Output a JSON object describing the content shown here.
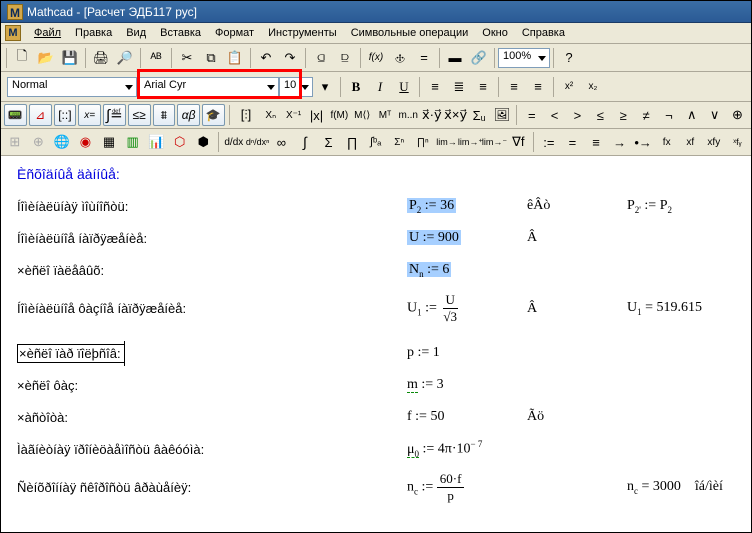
{
  "window": {
    "title": "Mathcad - [Расчет ЭДБ117 рус]"
  },
  "menu": {
    "file": "Файл",
    "edit": "Правка",
    "view": "Вид",
    "insert": "Вставка",
    "format": "Формат",
    "tools": "Инструменты",
    "symbolic": "Символьные операции",
    "window": "Окно",
    "help": "Справка"
  },
  "toolbar": {
    "zoom": "100%",
    "style": "Normal",
    "font": "Arial Cyr",
    "size": "10",
    "bold": "B",
    "italic": "I",
    "underline": "U"
  },
  "icons": {
    "new": "🗋",
    "open": "📂",
    "save": "💾",
    "print": "🖨",
    "preview": "🔎",
    "spell": "ᴬᴮ",
    "cut": "✂",
    "copy": "⧉",
    "paste": "📋",
    "undo": "↶",
    "redo": "↷",
    "align": "≡",
    "fx": "f(x)",
    "equals": "=",
    "help": "?"
  },
  "doc": {
    "header": "Èñõîäíûå äàííûå:",
    "r1": {
      "lbl": "Íîìèíàëüíàÿ ìîùíîñòü:",
      "expr_lhs": "P",
      "expr_sub": "2",
      "expr_rhs": " := 36",
      "unit": "êÂò",
      "res_lhs": "P",
      "res_sub": "2'",
      "res_rhs": " := P",
      "res_sub2": "2"
    },
    "r2": {
      "lbl": "Íîìèíàëüíîå íàïðÿæåíèå:",
      "expr": "U := 900",
      "unit": "Â"
    },
    "r3": {
      "lbl": "×èñëî ïàëåâûõ:",
      "expr_lhs": "N",
      "expr_sub": "n",
      "expr_rhs": " := 6"
    },
    "r4": {
      "lbl": "Íîìèíàëüíîå ôàçíîå íàïðÿæåíèå:",
      "u1": "U",
      "u1sub": "1",
      "assign": " := ",
      "numU": "U",
      "denSqrt": "√3",
      "unit": "Â",
      "res": "U",
      "res_sub": "1",
      "res_val": " = 519.615"
    },
    "r5": {
      "lbl": "×èñëî ïàð ïîëþñîâ:",
      "expr": "p := 1"
    },
    "r6": {
      "lbl": "×èñëî ôàç:",
      "expr_lhs": "m",
      "expr_rhs": " := 3"
    },
    "r7": {
      "lbl": "×àñòîòà:",
      "expr": "f := 50",
      "unit": "Ãö"
    },
    "r8": {
      "lbl": "Ìàãíèòíàÿ ïðîíèöàåìîñòü âàêóóìà:",
      "mu": "μ",
      "mu_sub": "0",
      "expr_rhs": " := 4π·10",
      "sup": "− 7"
    },
    "r9": {
      "lbl": "Ñèíõðîííàÿ ñêîðîñòü âðàùåíèÿ:",
      "nc": "n",
      "nc_sub": "c",
      "assign": " := ",
      "num": "60·f",
      "den": "p",
      "res": "n",
      "res_sub": "c",
      "res_val": " = 3000",
      "unit": "îá/ìèí"
    }
  }
}
